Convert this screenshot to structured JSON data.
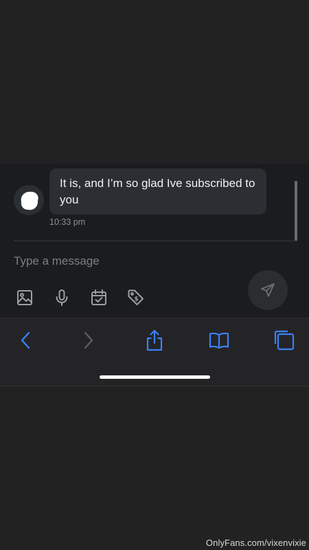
{
  "chat": {
    "message_text": "It is, and I’m so glad Ive subscribed to you",
    "timestamp": "10:33 pm"
  },
  "composer": {
    "placeholder": "Type a message",
    "tools": [
      "image-icon",
      "microphone-icon",
      "calendar-icon",
      "price-tag-icon"
    ],
    "send_icon": "send-icon"
  },
  "browser_toolbar": {
    "items": [
      "back-icon",
      "forward-icon",
      "share-icon",
      "bookmarks-icon",
      "tabs-icon"
    ],
    "accent_color": "#3b82f6"
  },
  "watermark": "OnlyFans.com/vixenvixie"
}
